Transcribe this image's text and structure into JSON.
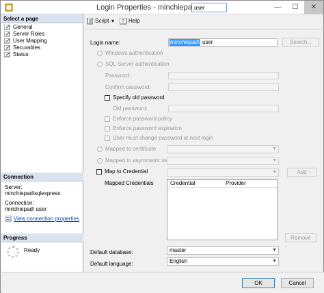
{
  "window": {
    "title_prefix": "Login Properties - minchiepad\\",
    "title_user": "user",
    "min_glyph": "—",
    "max_glyph": "☐",
    "close_glyph": "✕"
  },
  "left": {
    "select_page_header": "Select a page",
    "pages": [
      "General",
      "Server Roles",
      "User Mapping",
      "Securables",
      "Status"
    ],
    "connection_header": "Connection",
    "server_label": "Server:",
    "server_value": "minchiepad\\sqlexpress",
    "connection_label": "Connection:",
    "connection_value": "minchiepad\\ user",
    "view_link": "View connection properties",
    "progress_header": "Progress",
    "progress_status": "Ready"
  },
  "toolbar": {
    "script_label": "Script",
    "help_label": "Help"
  },
  "form": {
    "login_name_label": "Login name:",
    "login_name_selected": "minchiepad\\",
    "login_name_user": "user",
    "search_label": "Search...",
    "windows_auth": "Windows authentication",
    "sql_auth": "SQL Server authentication",
    "password_label": "Password:",
    "confirm_label": "Confirm password:",
    "specify_old": "Specify old password",
    "old_password_label": "Old password:",
    "enforce_policy": "Enforce password policy",
    "enforce_expiration": "Enforce password expiration",
    "must_change": "User must change password at next login",
    "mapped_cert": "Mapped to certificate",
    "mapped_asym": "Mapped to asymmetric key",
    "map_credential": "Map to Credential",
    "add_label": "Add",
    "mapped_credentials": "Mapped Credentials",
    "grid_col1": "Credential",
    "grid_col2": "Provider",
    "remove_label": "Remove",
    "default_db_label": "Default database:",
    "default_db_value": "master",
    "default_lang_label": "Default language:",
    "default_lang_value": "English"
  },
  "footer": {
    "ok_label": "OK",
    "cancel_label": "Cancel"
  },
  "colors": {
    "selection": "#3399ff",
    "link": "#0645ad",
    "pane_header": "#dbe3ef"
  }
}
